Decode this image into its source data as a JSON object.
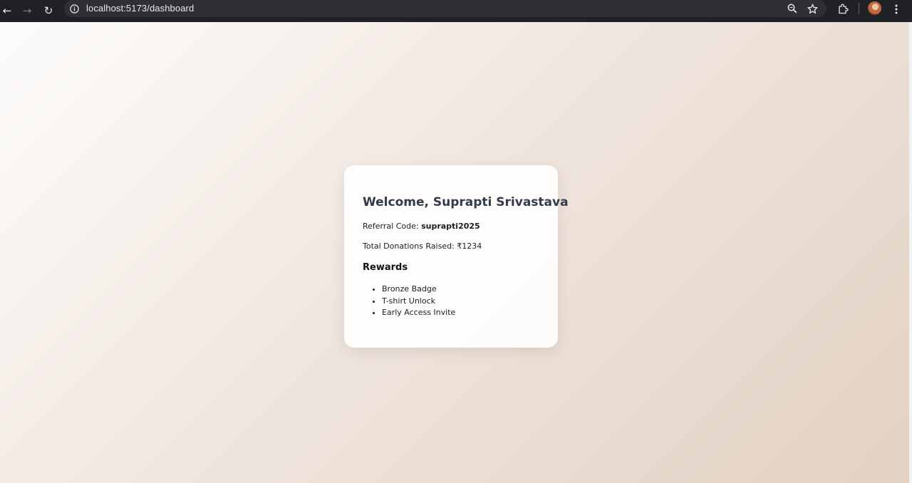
{
  "browser": {
    "back_icon": "arrow-left-icon",
    "forward_icon": "arrow-right-icon",
    "reload_icon": "reload-icon",
    "site_info_icon": "info-circle-icon",
    "url": "localhost:5173/dashboard",
    "zoom_icon": "zoom-icon",
    "bookmark_icon": "star-icon",
    "extensions_icon": "puzzle-icon",
    "profile_icon": "avatar",
    "menu_icon": "more-vertical-icon",
    "bar_color": "#202124"
  },
  "dashboard": {
    "welcome": "Welcome, Suprapti Srivastava",
    "referral_label": "Referral Code: ",
    "referral_code": "suprapti2025",
    "donations_text": "Total Donations Raised: ₹1234",
    "rewards_title": "Rewards",
    "rewards": [
      "Bronze Badge",
      "T-shirt Unlock",
      "Early Access Invite"
    ]
  }
}
